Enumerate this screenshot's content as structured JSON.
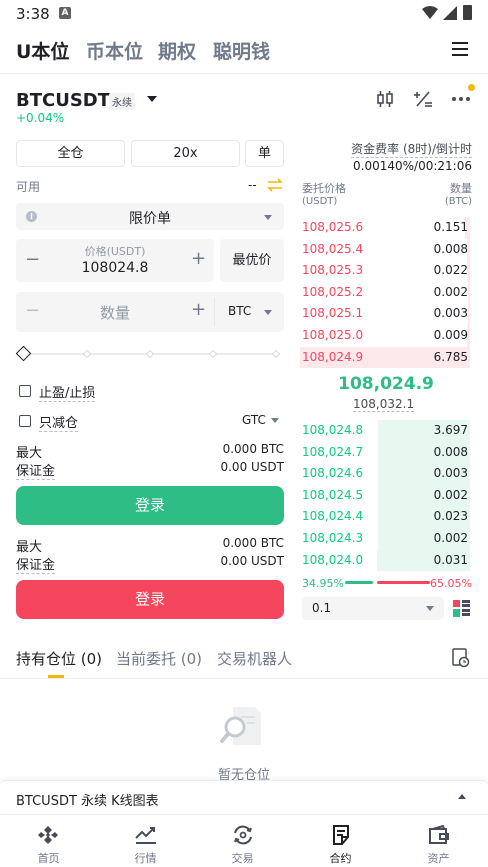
{
  "status_bar": {
    "time": "3:38",
    "app_icon": "A"
  },
  "top_tabs": [
    "U本位",
    "币本位",
    "期权",
    "聪明钱"
  ],
  "symbol": {
    "name": "BTCUSDT",
    "type": "永续",
    "change": "+0.04%"
  },
  "controls": {
    "margin_mode": "全仓",
    "leverage": "20x",
    "position_mode": "单"
  },
  "available": {
    "label": "可用",
    "value": "--"
  },
  "order_type": "限价单",
  "price": {
    "label": "价格(USDT)",
    "value": "108024.8",
    "best_price_label": "最优价"
  },
  "quantity": {
    "placeholder": "数量",
    "unit": "BTC"
  },
  "options": {
    "tp_sl": "止盈/止损",
    "reduce_only": "只减仓",
    "tif": "GTC"
  },
  "buy_block": {
    "max_label": "最大",
    "max_value": "0.000 BTC",
    "margin_label": "保证金",
    "margin_value": "0.00 USDT",
    "button": "登录"
  },
  "sell_block": {
    "max_label": "最大",
    "max_value": "0.000 BTC",
    "margin_label": "保证金",
    "margin_value": "0.00 USDT",
    "button": "登录"
  },
  "funding": {
    "label": "资金费率 (8时)/倒计时",
    "value": "0.00140%/00:21:06"
  },
  "orderbook_header": {
    "price_label": "委托价格",
    "price_unit": "(USDT)",
    "qty_label": "数量",
    "qty_unit": "(BTC)"
  },
  "asks": [
    {
      "price": "108,025.6",
      "qty": "0.151",
      "depth": 0.03
    },
    {
      "price": "108,025.4",
      "qty": "0.008",
      "depth": 0.02
    },
    {
      "price": "108,025.3",
      "qty": "0.022",
      "depth": 0.02
    },
    {
      "price": "108,025.2",
      "qty": "0.002",
      "depth": 0.01
    },
    {
      "price": "108,025.1",
      "qty": "0.003",
      "depth": 0.01
    },
    {
      "price": "108,025.0",
      "qty": "0.009",
      "depth": 0.02
    },
    {
      "price": "108,024.9",
      "qty": "6.785",
      "depth": 1.0
    }
  ],
  "last_price": "108,024.9",
  "mark_price": "108,032.1",
  "bids": [
    {
      "price": "108,024.8",
      "qty": "3.697",
      "depth": 0.54
    },
    {
      "price": "108,024.7",
      "qty": "0.008",
      "depth": 0.54
    },
    {
      "price": "108,024.6",
      "qty": "0.003",
      "depth": 0.54
    },
    {
      "price": "108,024.5",
      "qty": "0.002",
      "depth": 0.54
    },
    {
      "price": "108,024.4",
      "qty": "0.023",
      "depth": 0.54
    },
    {
      "price": "108,024.3",
      "qty": "0.002",
      "depth": 0.54
    },
    {
      "price": "108,024.0",
      "qty": "0.031",
      "depth": 0.55
    }
  ],
  "ratio": {
    "buy": "34.95%",
    "sell": "65.05%",
    "buy_fraction": 0.3495
  },
  "precision": "0.1",
  "bottom_tabs": [
    {
      "label": "持有仓位 (0)"
    },
    {
      "label": "当前委托 (0)"
    },
    {
      "label": "交易机器人"
    }
  ],
  "empty_state": "暂无仓位",
  "kline_bar": "BTCUSDT 永续 K线图表",
  "nav": [
    "首页",
    "行情",
    "交易",
    "合约",
    "资产"
  ],
  "colors": {
    "green": "#2ebd85",
    "red": "#f6465d",
    "accent": "#f0b90b"
  }
}
